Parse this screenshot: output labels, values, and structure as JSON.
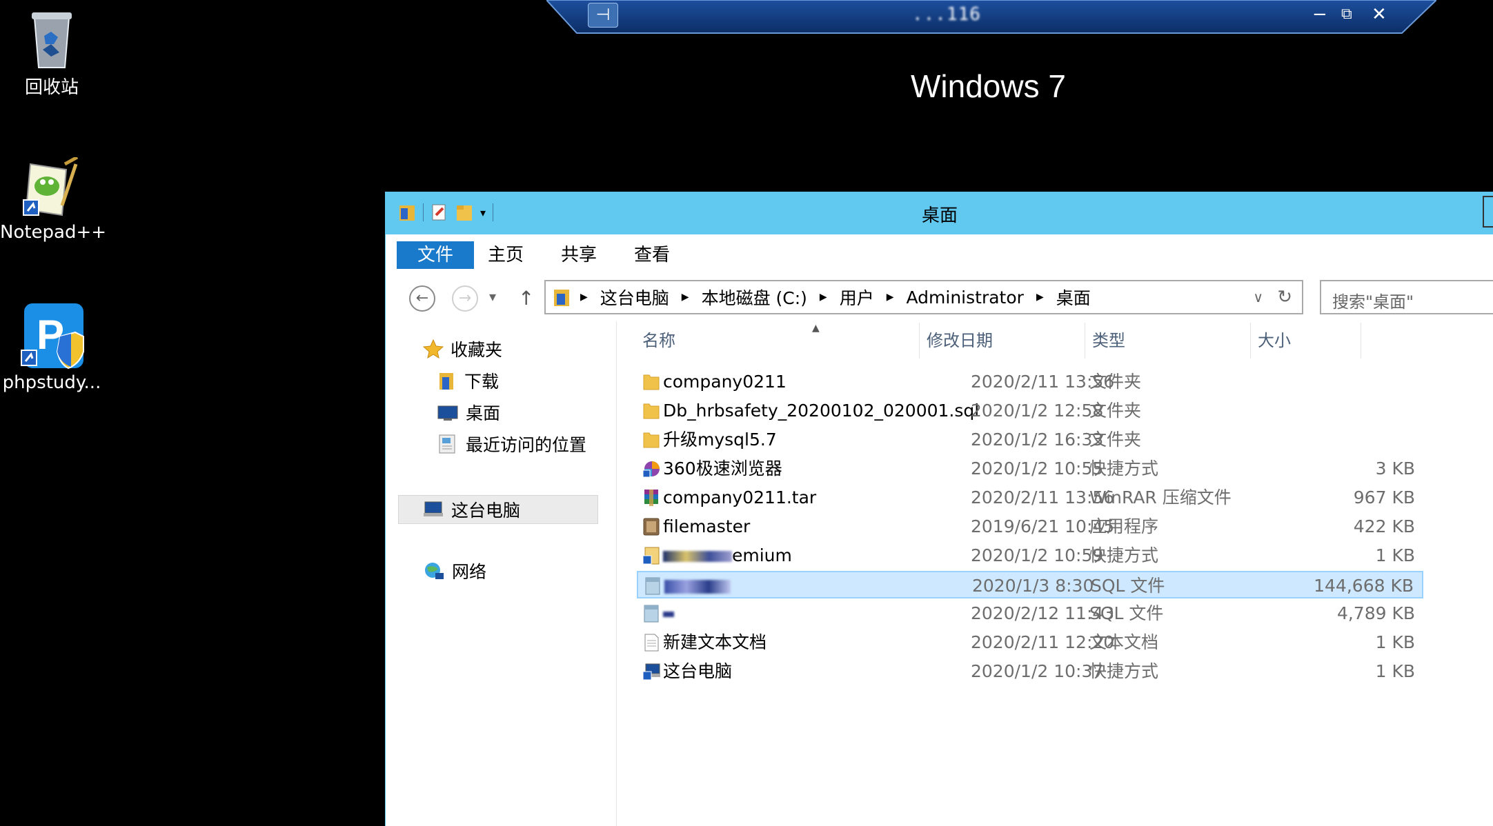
{
  "desktop": {
    "icons": [
      {
        "label": "回收站",
        "icon": "recycle-bin-icon"
      },
      {
        "label": "Notepad++",
        "icon": "notepadpp-icon"
      },
      {
        "label": "phpstudy...",
        "icon": "phpstudy-icon"
      }
    ]
  },
  "remote_bar": {
    "pin": "⊣",
    "host": "...116",
    "minimize": "−",
    "restore": "⧉",
    "close": "✕"
  },
  "watermark": "Windows 7",
  "explorer": {
    "title": "桌面",
    "ribbon_tabs": [
      "文件",
      "主页",
      "共享",
      "查看"
    ],
    "address": {
      "crumbs": [
        "这台电脑",
        "本地磁盘 (C:)",
        "用户",
        "Administrator",
        "桌面"
      ],
      "dropdown": "∨",
      "refresh": "↻"
    },
    "search_placeholder": "搜索\"桌面\"",
    "nav_buttons": {
      "back": "←",
      "forward": "→",
      "recent": "▾",
      "up": "↑"
    },
    "nav_pane": {
      "favorites": "收藏夹",
      "downloads": "下载",
      "desktop": "桌面",
      "recent": "最近访问的位置",
      "this_pc": "这台电脑",
      "network": "网络"
    },
    "columns": {
      "name": "名称",
      "modified": "修改日期",
      "type": "类型",
      "size": "大小"
    },
    "files": [
      {
        "name": "company0211",
        "date": "2020/2/11 13:56",
        "type": "文件夹",
        "size": "",
        "icon": "folder-icon"
      },
      {
        "name": "Db_hrbsafety_20200102_020001.sql",
        "date": "2020/1/2 12:58",
        "type": "文件夹",
        "size": "",
        "icon": "folder-icon"
      },
      {
        "name": "升级mysql5.7",
        "date": "2020/1/2 16:33",
        "type": "文件夹",
        "size": "",
        "icon": "folder-icon"
      },
      {
        "name": "360极速浏览器",
        "date": "2020/1/2 10:55",
        "type": "快捷方式",
        "size": "3 KB",
        "icon": "browser-360-icon"
      },
      {
        "name": "company0211.tar",
        "date": "2020/2/11 13:56",
        "type": "WinRAR 压缩文件",
        "size": "967 KB",
        "icon": "winrar-icon"
      },
      {
        "name": "filemaster",
        "date": "2019/6/21 10:45",
        "type": "应用程序",
        "size": "422 KB",
        "icon": "app-icon"
      },
      {
        "name": "emium",
        "date": "2020/1/2 10:59",
        "type": "快捷方式",
        "size": "1 KB",
        "icon": "shortcut-icon"
      },
      {
        "name": "",
        "date": "2020/1/3 8:30",
        "type": "SQL 文件",
        "size": "144,668 KB",
        "icon": "sql-file-icon"
      },
      {
        "name": "",
        "date": "2020/2/12 11:43",
        "type": "SQL 文件",
        "size": "4,789 KB",
        "icon": "sql-file-icon"
      },
      {
        "name": "新建文本文档",
        "date": "2020/2/11 12:20",
        "type": "文本文档",
        "size": "1 KB",
        "icon": "text-file-icon"
      },
      {
        "name": "这台电脑",
        "date": "2020/1/2 10:37",
        "type": "快捷方式",
        "size": "1 KB",
        "icon": "computer-shortcut-icon"
      }
    ],
    "selected_index": 7
  }
}
